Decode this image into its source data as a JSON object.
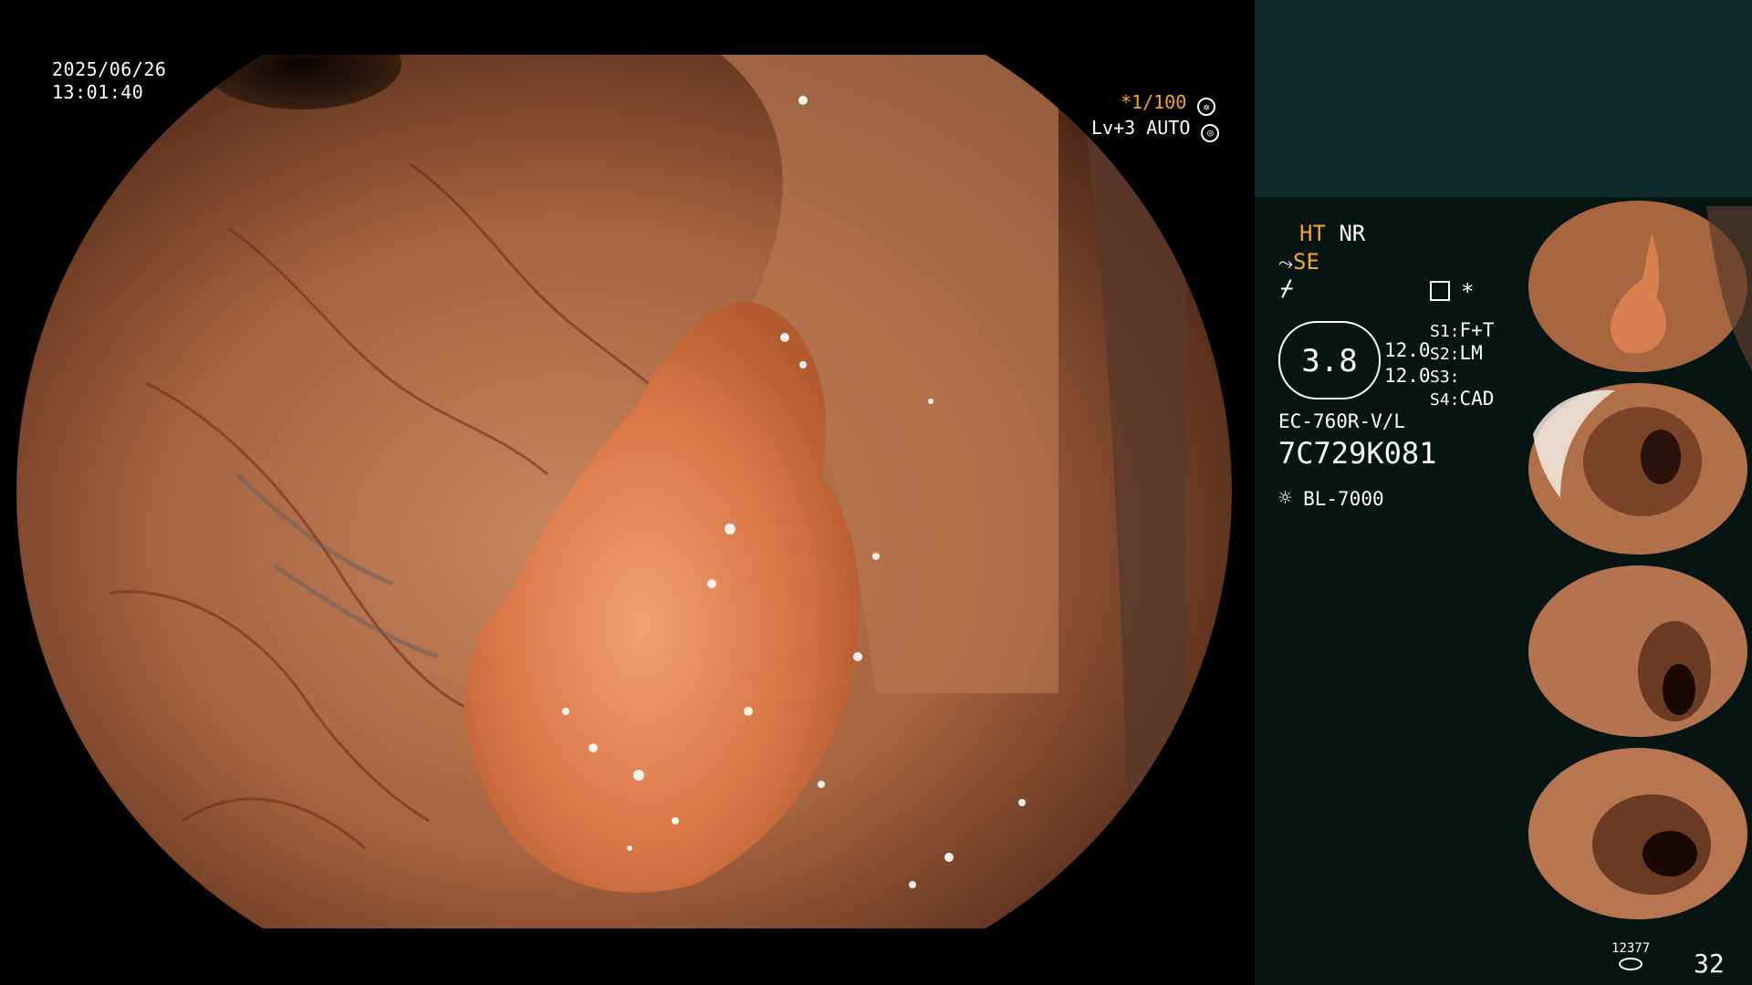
{
  "main": {
    "date": "2025/06/26",
    "time": "13:01:40",
    "shutter": "*1/100",
    "level": "Lv+3",
    "mode": "AUTO"
  },
  "panel": {
    "enh_ht": "HT",
    "enh_nr": "NR",
    "enh_se": "SE",
    "star": "*",
    "dial_value": "3.8",
    "side_val1": "12.0",
    "side_val2": "12.0",
    "s1_label": "S1:",
    "s1_value": "F+T",
    "s2_label": "S2:",
    "s2_value": "LM",
    "s3_label": "S3:",
    "s3_value": "",
    "s4_label": "S4:",
    "s4_value": "CAD",
    "scope_model": "EC-760R-V/L",
    "scope_serial": "7C729K081",
    "light_source": "BL-7000",
    "storage_count": "12377",
    "image_count": "32"
  },
  "colors": {
    "accent": "#f5a623",
    "panel_bg": "#061412",
    "top_panel_bg": "#0d2a2b"
  },
  "icons": [
    "aperture-icon",
    "auto-iris-icon",
    "scope-connector-icon",
    "freeze-icon",
    "memo-icon",
    "light-source-icon",
    "storage-icon"
  ]
}
